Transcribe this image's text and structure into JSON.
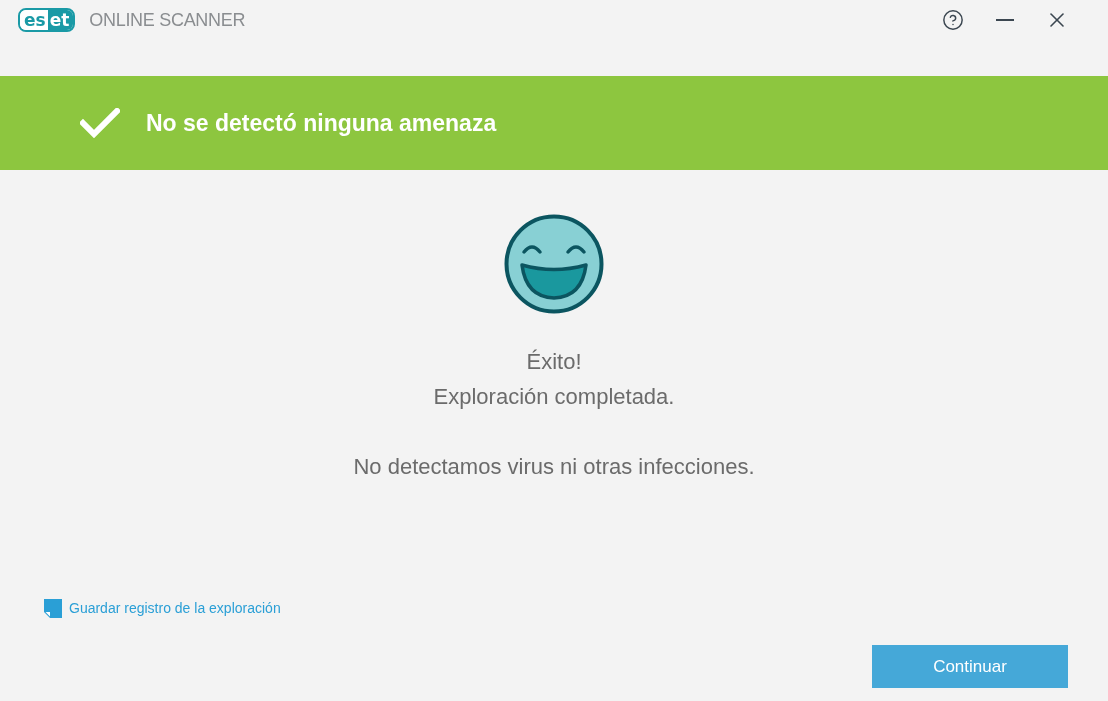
{
  "titlebar": {
    "logo": "eset",
    "product": "ONLINE SCANNER"
  },
  "banner": {
    "title": "No se detectó ninguna amenaza"
  },
  "result": {
    "lines": [
      "Éxito!",
      "Exploración completada."
    ],
    "message": "No detectamos virus ni otras infecciones."
  },
  "save_log_link": "Guardar registro de la exploración",
  "primary_button": "Continuar"
}
